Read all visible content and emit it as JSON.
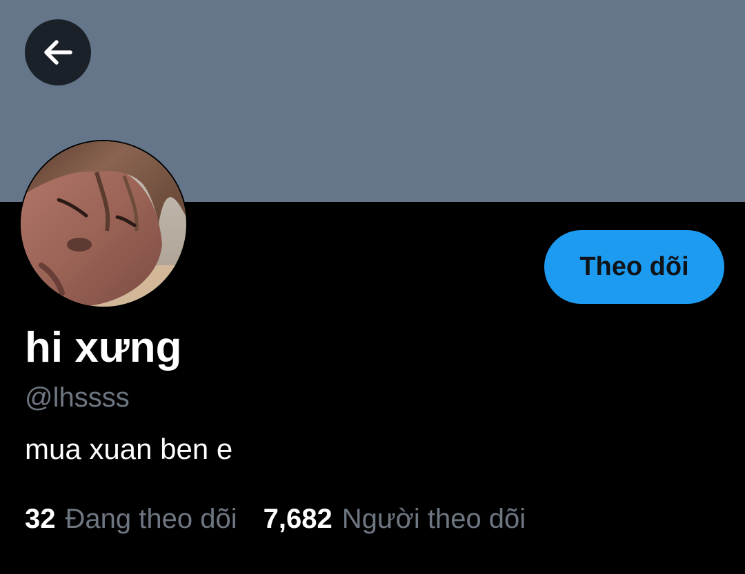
{
  "header": {
    "back_icon": "arrow-left-icon",
    "banner_color": "#66768a"
  },
  "profile": {
    "display_name": "hi xưng",
    "handle": "@lhssss",
    "bio": "mua xuan ben e",
    "follow_button_label": "Theo dõi",
    "accent_color": "#1d9bf0"
  },
  "stats": {
    "following": {
      "count": "32",
      "label": "Đang theo dõi"
    },
    "followers": {
      "count": "7,682",
      "label": "Người theo dõi"
    }
  }
}
